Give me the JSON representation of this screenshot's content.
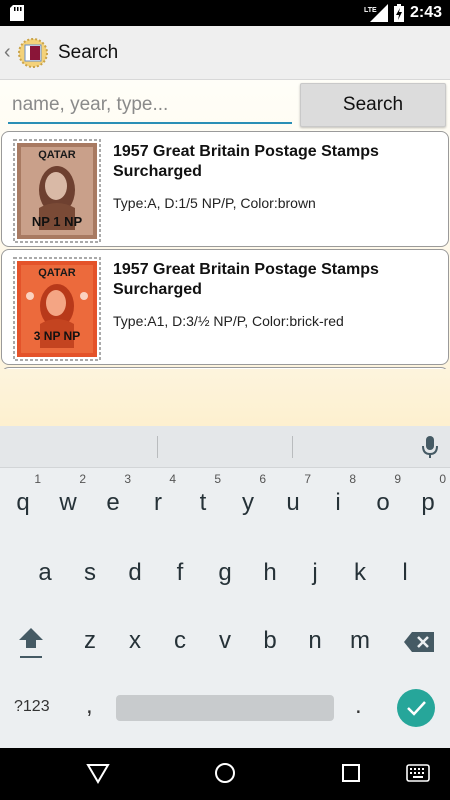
{
  "status_bar": {
    "time": "2:43",
    "network": "LTE",
    "icons": [
      "sd-card-icon",
      "lte-signal-icon",
      "battery-charging-icon"
    ]
  },
  "app_bar": {
    "back_icon": "chevron-left-icon",
    "logo": "qatar-flag-stamp-logo",
    "title": "Search"
  },
  "search": {
    "placeholder": "name, year, type...",
    "value": "",
    "button_label": "Search"
  },
  "results": [
    {
      "stamp": {
        "country": "QATAR",
        "value": "NP 1 NP",
        "color": "brown"
      },
      "title": "1957 Great Britain Postage Stamps Surcharged",
      "meta": "Type:A, D:1/5 NP/P, Color:brown"
    },
    {
      "stamp": {
        "country": "QATAR",
        "value": "3 NP NP",
        "color": "brick-red"
      },
      "title": "1957 Great Britain Postage Stamps Surcharged",
      "meta": "Type:A1, D:3/½ NP/P, Color:brick-red"
    }
  ],
  "keyboard": {
    "row1": [
      {
        "k": "q",
        "h": "1"
      },
      {
        "k": "w",
        "h": "2"
      },
      {
        "k": "e",
        "h": "3"
      },
      {
        "k": "r",
        "h": "4"
      },
      {
        "k": "t",
        "h": "5"
      },
      {
        "k": "y",
        "h": "6"
      },
      {
        "k": "u",
        "h": "7"
      },
      {
        "k": "i",
        "h": "8"
      },
      {
        "k": "o",
        "h": "9"
      },
      {
        "k": "p",
        "h": "0"
      }
    ],
    "row2": [
      "a",
      "s",
      "d",
      "f",
      "g",
      "h",
      "j",
      "k",
      "l"
    ],
    "row3": [
      "z",
      "x",
      "c",
      "v",
      "b",
      "n",
      "m"
    ],
    "symbols_label": "?123",
    "comma": ",",
    "period": ".",
    "icons": [
      "mic-icon",
      "shift-icon",
      "backspace-icon",
      "enter-check-icon"
    ]
  },
  "nav": {
    "icons": [
      "back-triangle-icon",
      "home-circle-icon",
      "recents-square-icon",
      "keyboard-switch-icon"
    ]
  },
  "colors": {
    "accent": "#2a8fb6",
    "enter_key": "#26a69a",
    "stamp_brown": "#8b5a3c",
    "stamp_red": "#e85a2c"
  }
}
